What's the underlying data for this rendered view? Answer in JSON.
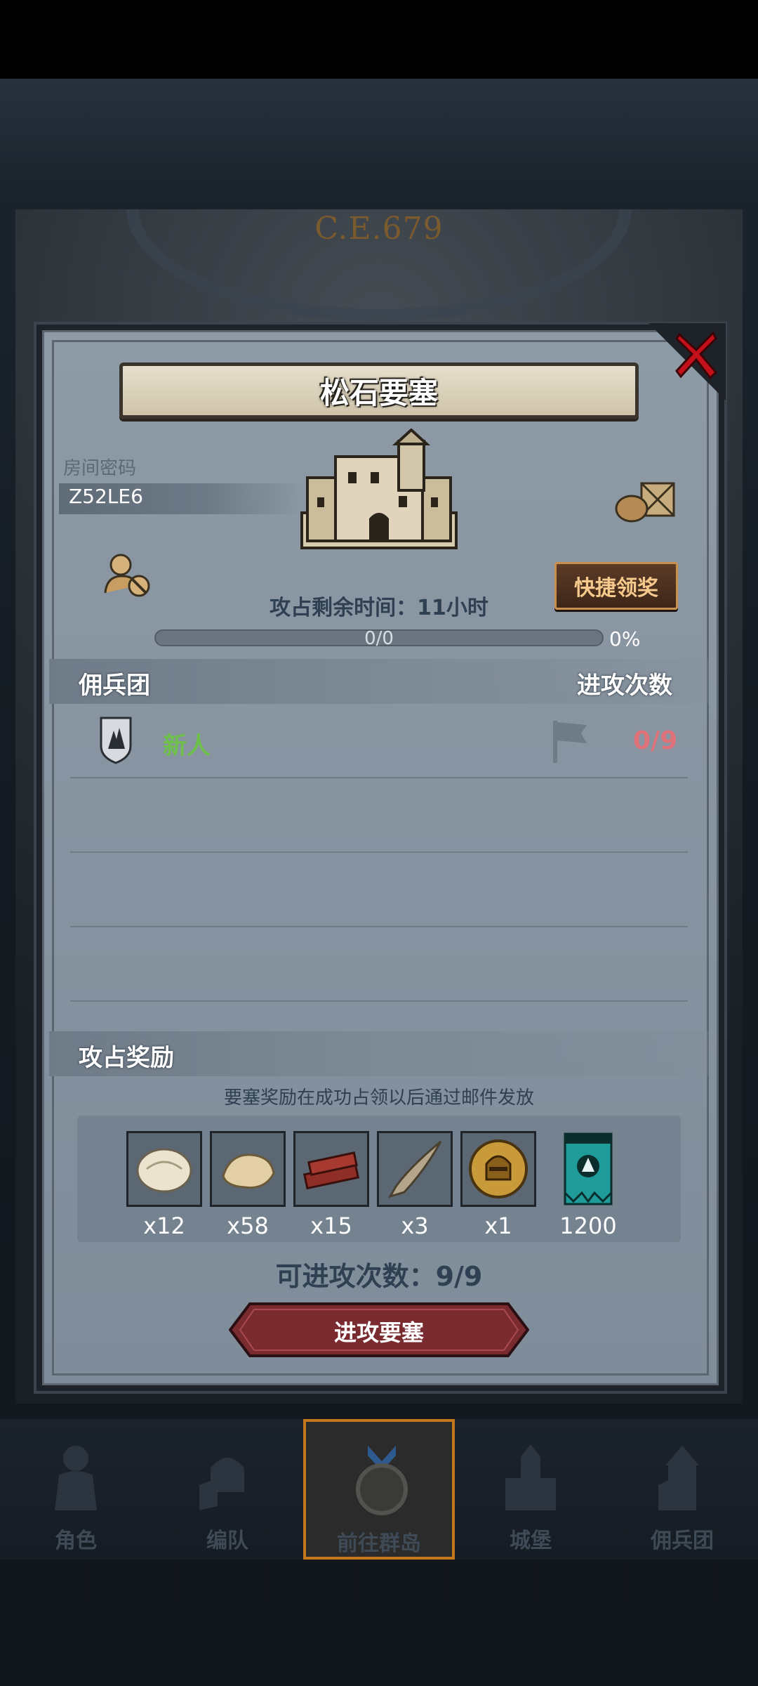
{
  "background": {
    "year_text": "C.E.679"
  },
  "dialog": {
    "title": "松石要塞",
    "room_label": "房间密码",
    "room_code": "Z52LE6",
    "quick_claim_label": "快捷领奖",
    "remaining_time": "攻占剩余时间：11小时",
    "progress_text": "0/0",
    "progress_percent": "0%",
    "progress_fraction": 0,
    "section_mercenary": "佣兵团",
    "section_attacks": "进攻次数",
    "members": [
      {
        "name": "新人",
        "attack_count": "0/9",
        "name_color": "#6ec04b"
      }
    ],
    "section_rewards": "攻占奖励",
    "reward_note": "要塞奖励在成功占领以后通过邮件发放",
    "rewards": [
      {
        "icon": "fleece-icon",
        "qty": "x12"
      },
      {
        "icon": "fur-pelt-icon",
        "qty": "x58"
      },
      {
        "icon": "wood-planks-icon",
        "qty": "x15"
      },
      {
        "icon": "horn-icon",
        "qty": "x3"
      },
      {
        "icon": "knight-helmet-medal-icon",
        "qty": "x1"
      },
      {
        "icon": "guild-banner-icon",
        "qty": "1200"
      }
    ],
    "attack_count_text": "可进攻次数：9/9",
    "attack_button": "进攻要塞"
  },
  "nav": {
    "items": [
      {
        "label": "角色",
        "icon": "knight-armor-icon"
      },
      {
        "label": "编队",
        "icon": "helmet-shield-icon"
      },
      {
        "label": "前往群岛",
        "icon": "compass-emblem-icon",
        "active": true
      },
      {
        "label": "城堡",
        "icon": "castle-icon"
      },
      {
        "label": "佣兵团",
        "icon": "mercenary-tower-icon"
      }
    ]
  },
  "colors": {
    "accent_active": "#c3781d",
    "attack_red": "#e0727a",
    "member_green": "#6ec04b",
    "button_gold_text": "#f6c98c"
  }
}
